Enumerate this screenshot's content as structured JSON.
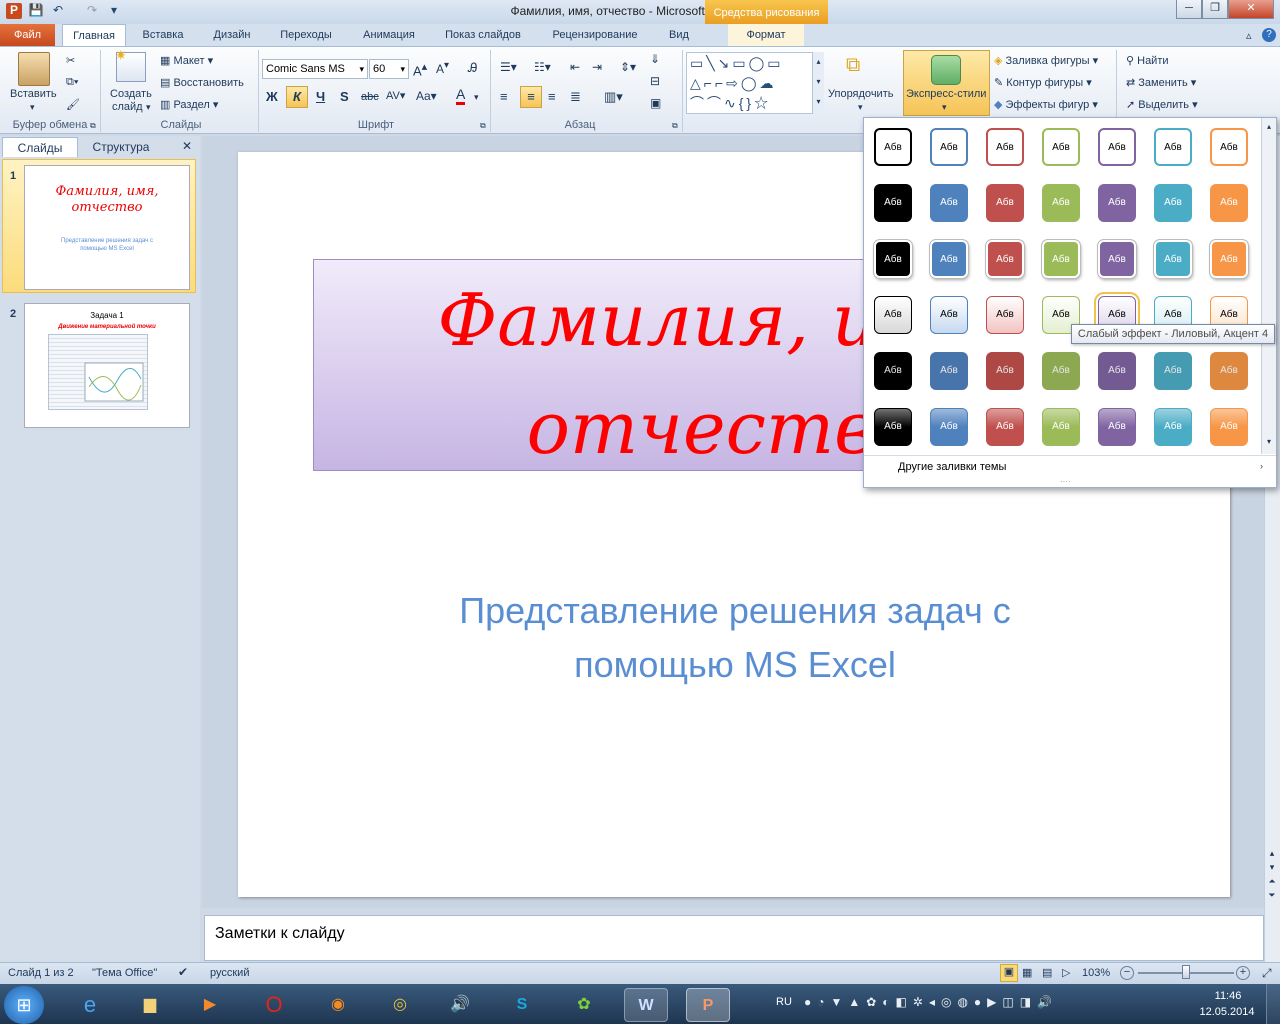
{
  "window": {
    "title": "Фамилия, имя, отчество  -  Microsoft PowerPoint",
    "context_tab": "Средства рисования"
  },
  "tabs": [
    "Файл",
    "Главная",
    "Вставка",
    "Дизайн",
    "Переходы",
    "Анимация",
    "Показ слайдов",
    "Рецензирование",
    "Вид",
    "Формат"
  ],
  "ribbon": {
    "clipboard": {
      "paste": "Вставить",
      "label": "Буфер обмена"
    },
    "slides": {
      "create": "Создать",
      "create2": "слайд",
      "layout": "Макет",
      "reset": "Восстановить",
      "section": "Раздел",
      "label": "Слайды"
    },
    "font": {
      "family": "Comic Sans MS",
      "size": "60",
      "label": "Шрифт"
    },
    "paragraph": {
      "label": "Абзац"
    },
    "drawing": {
      "arrange": "Упорядочить",
      "quick_styles": "Экспресс-стили",
      "fill": "Заливка фигуры",
      "outline": "Контур фигуры",
      "effects": "Эффекты фигур"
    },
    "editing": {
      "find": "Найти",
      "replace": "Заменить",
      "select": "Выделить"
    }
  },
  "panel_tabs": {
    "slides": "Слайды",
    "outline": "Структура"
  },
  "thumbnails": [
    {
      "num": "1",
      "title": "Фамилия, имя, отчество",
      "subtitle": "Представление решения задач с помощью MS Excel"
    },
    {
      "num": "2",
      "title": "Задача 1",
      "subtitle": "Движение материальной точки"
    }
  ],
  "slide": {
    "title_line1": "Фамилия, имя,",
    "title_line2": "отчество",
    "subtitle_line1": "Представление решения задач с",
    "subtitle_line2": "помощью MS Excel"
  },
  "notes": "Заметки к слайду",
  "gallery": {
    "swatch_label": "Абв",
    "more": "Другие заливки темы",
    "tooltip": "Слабый эффект - Лиловый, Акцент 4"
  },
  "status": {
    "slide": "Слайд 1 из 2",
    "theme": "\"Тема Office\"",
    "lang": "русский",
    "zoom": "103%"
  },
  "taskbar": {
    "lang": "RU",
    "time": "11:46",
    "date": "12.05.2014"
  },
  "colors": {
    "accent_cols": [
      "#000000",
      "#4f81bd",
      "#c0504d",
      "#9bbb59",
      "#8064a2",
      "#4bacc6",
      "#f79646"
    ]
  }
}
